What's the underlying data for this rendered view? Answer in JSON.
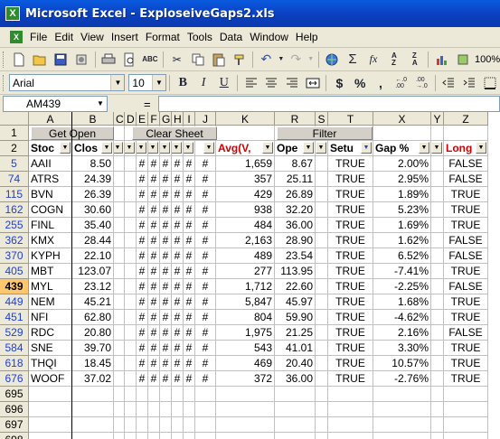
{
  "window": {
    "title": "Microsoft Excel - ExploseiveGaps2.xls",
    "app_icon": "excel-icon"
  },
  "menu": [
    "File",
    "Edit",
    "View",
    "Insert",
    "Format",
    "Tools",
    "Data",
    "Window",
    "Help"
  ],
  "toolbar": {
    "zoom": "100%"
  },
  "format_bar": {
    "font": "Arial",
    "size": "10",
    "bold": "B",
    "italic": "I",
    "underline": "U",
    "currency": "$",
    "percent": "%",
    "comma": ","
  },
  "formula_bar": {
    "name_box": "AM439",
    "equals": "=",
    "formula": ""
  },
  "columns": [
    "A",
    "B",
    "C",
    "D",
    "E",
    "F",
    "G",
    "H",
    "I",
    "J",
    "K",
    "R",
    "S",
    "T",
    "X",
    "Y",
    "Z"
  ],
  "row1": {
    "row": "1",
    "get_open": "Get Open",
    "clear_sheet": "Clear Sheet",
    "filter": "Filter"
  },
  "row2": {
    "row": "2",
    "stock": "Stoc",
    "close": "Clos",
    "avg": "Avg(V,",
    "open": "Ope",
    "setup": "Setu",
    "gap": "Gap %",
    "long": "Long"
  },
  "rows": [
    {
      "row": "5",
      "stock": "AAII",
      "close": "8.50",
      "hash": "#",
      "avg": "1,659",
      "open": "8.67",
      "setup": "TRUE",
      "gap": "2.00%",
      "long": "FALSE"
    },
    {
      "row": "74",
      "stock": "ATRS",
      "close": "24.39",
      "hash": "#",
      "avg": "357",
      "open": "25.11",
      "setup": "TRUE",
      "gap": "2.95%",
      "long": "FALSE"
    },
    {
      "row": "115",
      "stock": "BVN",
      "close": "26.39",
      "hash": "#",
      "avg": "429",
      "open": "26.89",
      "setup": "TRUE",
      "gap": "1.89%",
      "long": "TRUE"
    },
    {
      "row": "162",
      "stock": "COGN",
      "close": "30.60",
      "hash": "#",
      "avg": "938",
      "open": "32.20",
      "setup": "TRUE",
      "gap": "5.23%",
      "long": "TRUE"
    },
    {
      "row": "255",
      "stock": "FINL",
      "close": "35.40",
      "hash": "#",
      "avg": "484",
      "open": "36.00",
      "setup": "TRUE",
      "gap": "1.69%",
      "long": "TRUE"
    },
    {
      "row": "362",
      "stock": "KMX",
      "close": "28.44",
      "hash": "#",
      "avg": "2,163",
      "open": "28.90",
      "setup": "TRUE",
      "gap": "1.62%",
      "long": "FALSE"
    },
    {
      "row": "370",
      "stock": "KYPH",
      "close": "22.10",
      "hash": "#",
      "avg": "489",
      "open": "23.54",
      "setup": "TRUE",
      "gap": "6.52%",
      "long": "FALSE"
    },
    {
      "row": "405",
      "stock": "MBT",
      "close": "123.07",
      "hash": "#",
      "avg": "277",
      "open": "113.95",
      "setup": "TRUE",
      "gap": "-7.41%",
      "long": "TRUE"
    },
    {
      "row": "439",
      "stock": "MYL",
      "close": "23.12",
      "hash": "#",
      "avg": "1,712",
      "open": "22.60",
      "setup": "TRUE",
      "gap": "-2.25%",
      "long": "FALSE",
      "active": true
    },
    {
      "row": "449",
      "stock": "NEM",
      "close": "45.21",
      "hash": "#",
      "avg": "5,847",
      "open": "45.97",
      "setup": "TRUE",
      "gap": "1.68%",
      "long": "TRUE"
    },
    {
      "row": "451",
      "stock": "NFI",
      "close": "62.80",
      "hash": "#",
      "avg": "804",
      "open": "59.90",
      "setup": "TRUE",
      "gap": "-4.62%",
      "long": "TRUE"
    },
    {
      "row": "529",
      "stock": "RDC",
      "close": "20.80",
      "hash": "#",
      "avg": "1,975",
      "open": "21.25",
      "setup": "TRUE",
      "gap": "2.16%",
      "long": "FALSE"
    },
    {
      "row": "584",
      "stock": "SNE",
      "close": "39.70",
      "hash": "#",
      "avg": "543",
      "open": "41.01",
      "setup": "TRUE",
      "gap": "3.30%",
      "long": "TRUE"
    },
    {
      "row": "618",
      "stock": "THQI",
      "close": "18.45",
      "hash": "#",
      "avg": "469",
      "open": "20.40",
      "setup": "TRUE",
      "gap": "10.57%",
      "long": "TRUE"
    },
    {
      "row": "676",
      "stock": "WOOF",
      "close": "37.02",
      "hash": "#",
      "avg": "372",
      "open": "36.00",
      "setup": "TRUE",
      "gap": "-2.76%",
      "long": "TRUE"
    }
  ],
  "empty_rows": [
    "695",
    "696",
    "697",
    "698"
  ],
  "colors": {
    "title_bar": "#0a4fd0",
    "filtered_row_number": "#1f3fd0",
    "red_header": "#d00000"
  }
}
